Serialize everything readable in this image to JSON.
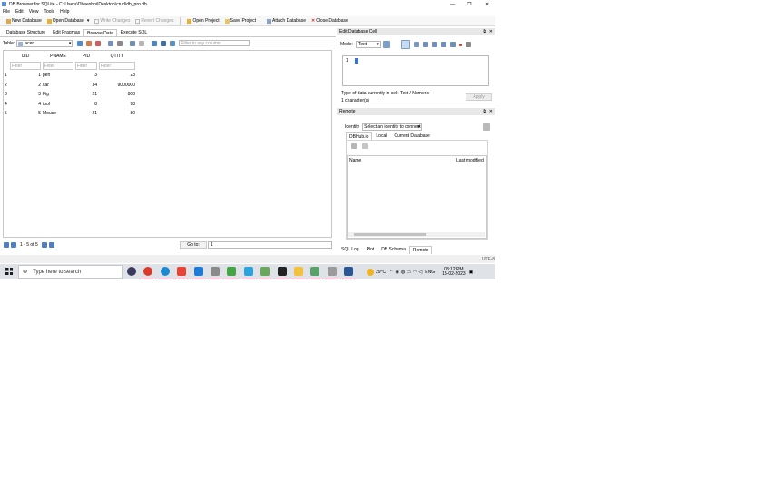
{
  "window": {
    "title": "DB Browser for SQLite - C:\\Users\\Dheeshni\\Desktop\\crud\\db_pro.db",
    "min": "—",
    "max": "❐",
    "close": "✕"
  },
  "menu": [
    "File",
    "Edit",
    "View",
    "Tools",
    "Help"
  ],
  "toolbar": {
    "new_db": "New Database",
    "open_db": "Open Database",
    "write": "Write Changes",
    "revert": "Revert Changes",
    "open_project": "Open Project",
    "save_project": "Save Project",
    "attach": "Attach Database",
    "close_db": "Close Database"
  },
  "main_tabs": [
    "Database Structure",
    "Edit Pragmas",
    "Browse Data",
    "Execute SQL"
  ],
  "browse": {
    "table_label": "Table:",
    "table_value": "acer",
    "filter_placeholder": "Filter in any column",
    "columns": [
      "UID",
      "PNAME",
      "PID",
      "QTITY"
    ],
    "filter_text": "Filter",
    "rows": [
      {
        "n": "1",
        "uid": "1",
        "pname": "pen",
        "pid": "3",
        "qty": "23"
      },
      {
        "n": "2",
        "uid": "2",
        "pname": "car",
        "pid": "34",
        "qty": "9000000"
      },
      {
        "n": "3",
        "uid": "3",
        "pname": "Fig",
        "pid": "21",
        "qty": "800"
      },
      {
        "n": "4",
        "uid": "4",
        "pname": "tool",
        "pid": "8",
        "qty": "98"
      },
      {
        "n": "5",
        "uid": "5",
        "pname": "Mouse",
        "pid": "21",
        "qty": "80"
      }
    ],
    "pager": "1 - 5 of 5",
    "goto_label": "Go to:",
    "goto_value": "1"
  },
  "edit_cell": {
    "title": "Edit Database Cell",
    "mode_label": "Mode:",
    "mode_value": "Text",
    "line_no": "1",
    "type_info": "Type of data currently in cell: Text / Numeric",
    "size_info": "1 character(s)",
    "apply": "Apply"
  },
  "remote": {
    "title": "Remote",
    "identity_label": "Identity",
    "identity_value": "Select an identity to connect",
    "tabs": [
      "DBHub.io",
      "Local",
      "Current Database"
    ],
    "col_name": "Name",
    "col_modified": "Last modified"
  },
  "bottom_tabs": [
    "SQL Log",
    "Plot",
    "DB Schema",
    "Remote"
  ],
  "status": {
    "encoding": "UTF-8"
  },
  "taskbar": {
    "search_placeholder": "Type here to search",
    "weather": "29°C",
    "lang": "ENG",
    "time": "08:12 PM",
    "date": "15-02-2023",
    "apps": [
      {
        "name": "app-icon-1",
        "color": "#3a3a5c"
      },
      {
        "name": "app-icon-2",
        "color": "#d83b2b"
      },
      {
        "name": "edge-icon",
        "color": "#1b8ad1"
      },
      {
        "name": "chrome-icon",
        "color": "#e94335"
      },
      {
        "name": "vscode-icon",
        "color": "#1f7bd6"
      },
      {
        "name": "files-icon",
        "color": "#8a8a8a"
      },
      {
        "name": "app-icon-7",
        "color": "#47a447"
      },
      {
        "name": "telegram-icon",
        "color": "#2aa3de"
      },
      {
        "name": "app-icon-9",
        "color": "#69a85c"
      },
      {
        "name": "terminal-icon",
        "color": "#222222"
      },
      {
        "name": "folder-icon",
        "color": "#f3c23d"
      },
      {
        "name": "app-icon-12",
        "color": "#5aa06b"
      },
      {
        "name": "app-icon-13",
        "color": "#9b9b9b"
      },
      {
        "name": "word-icon",
        "color": "#2b5797"
      }
    ]
  }
}
